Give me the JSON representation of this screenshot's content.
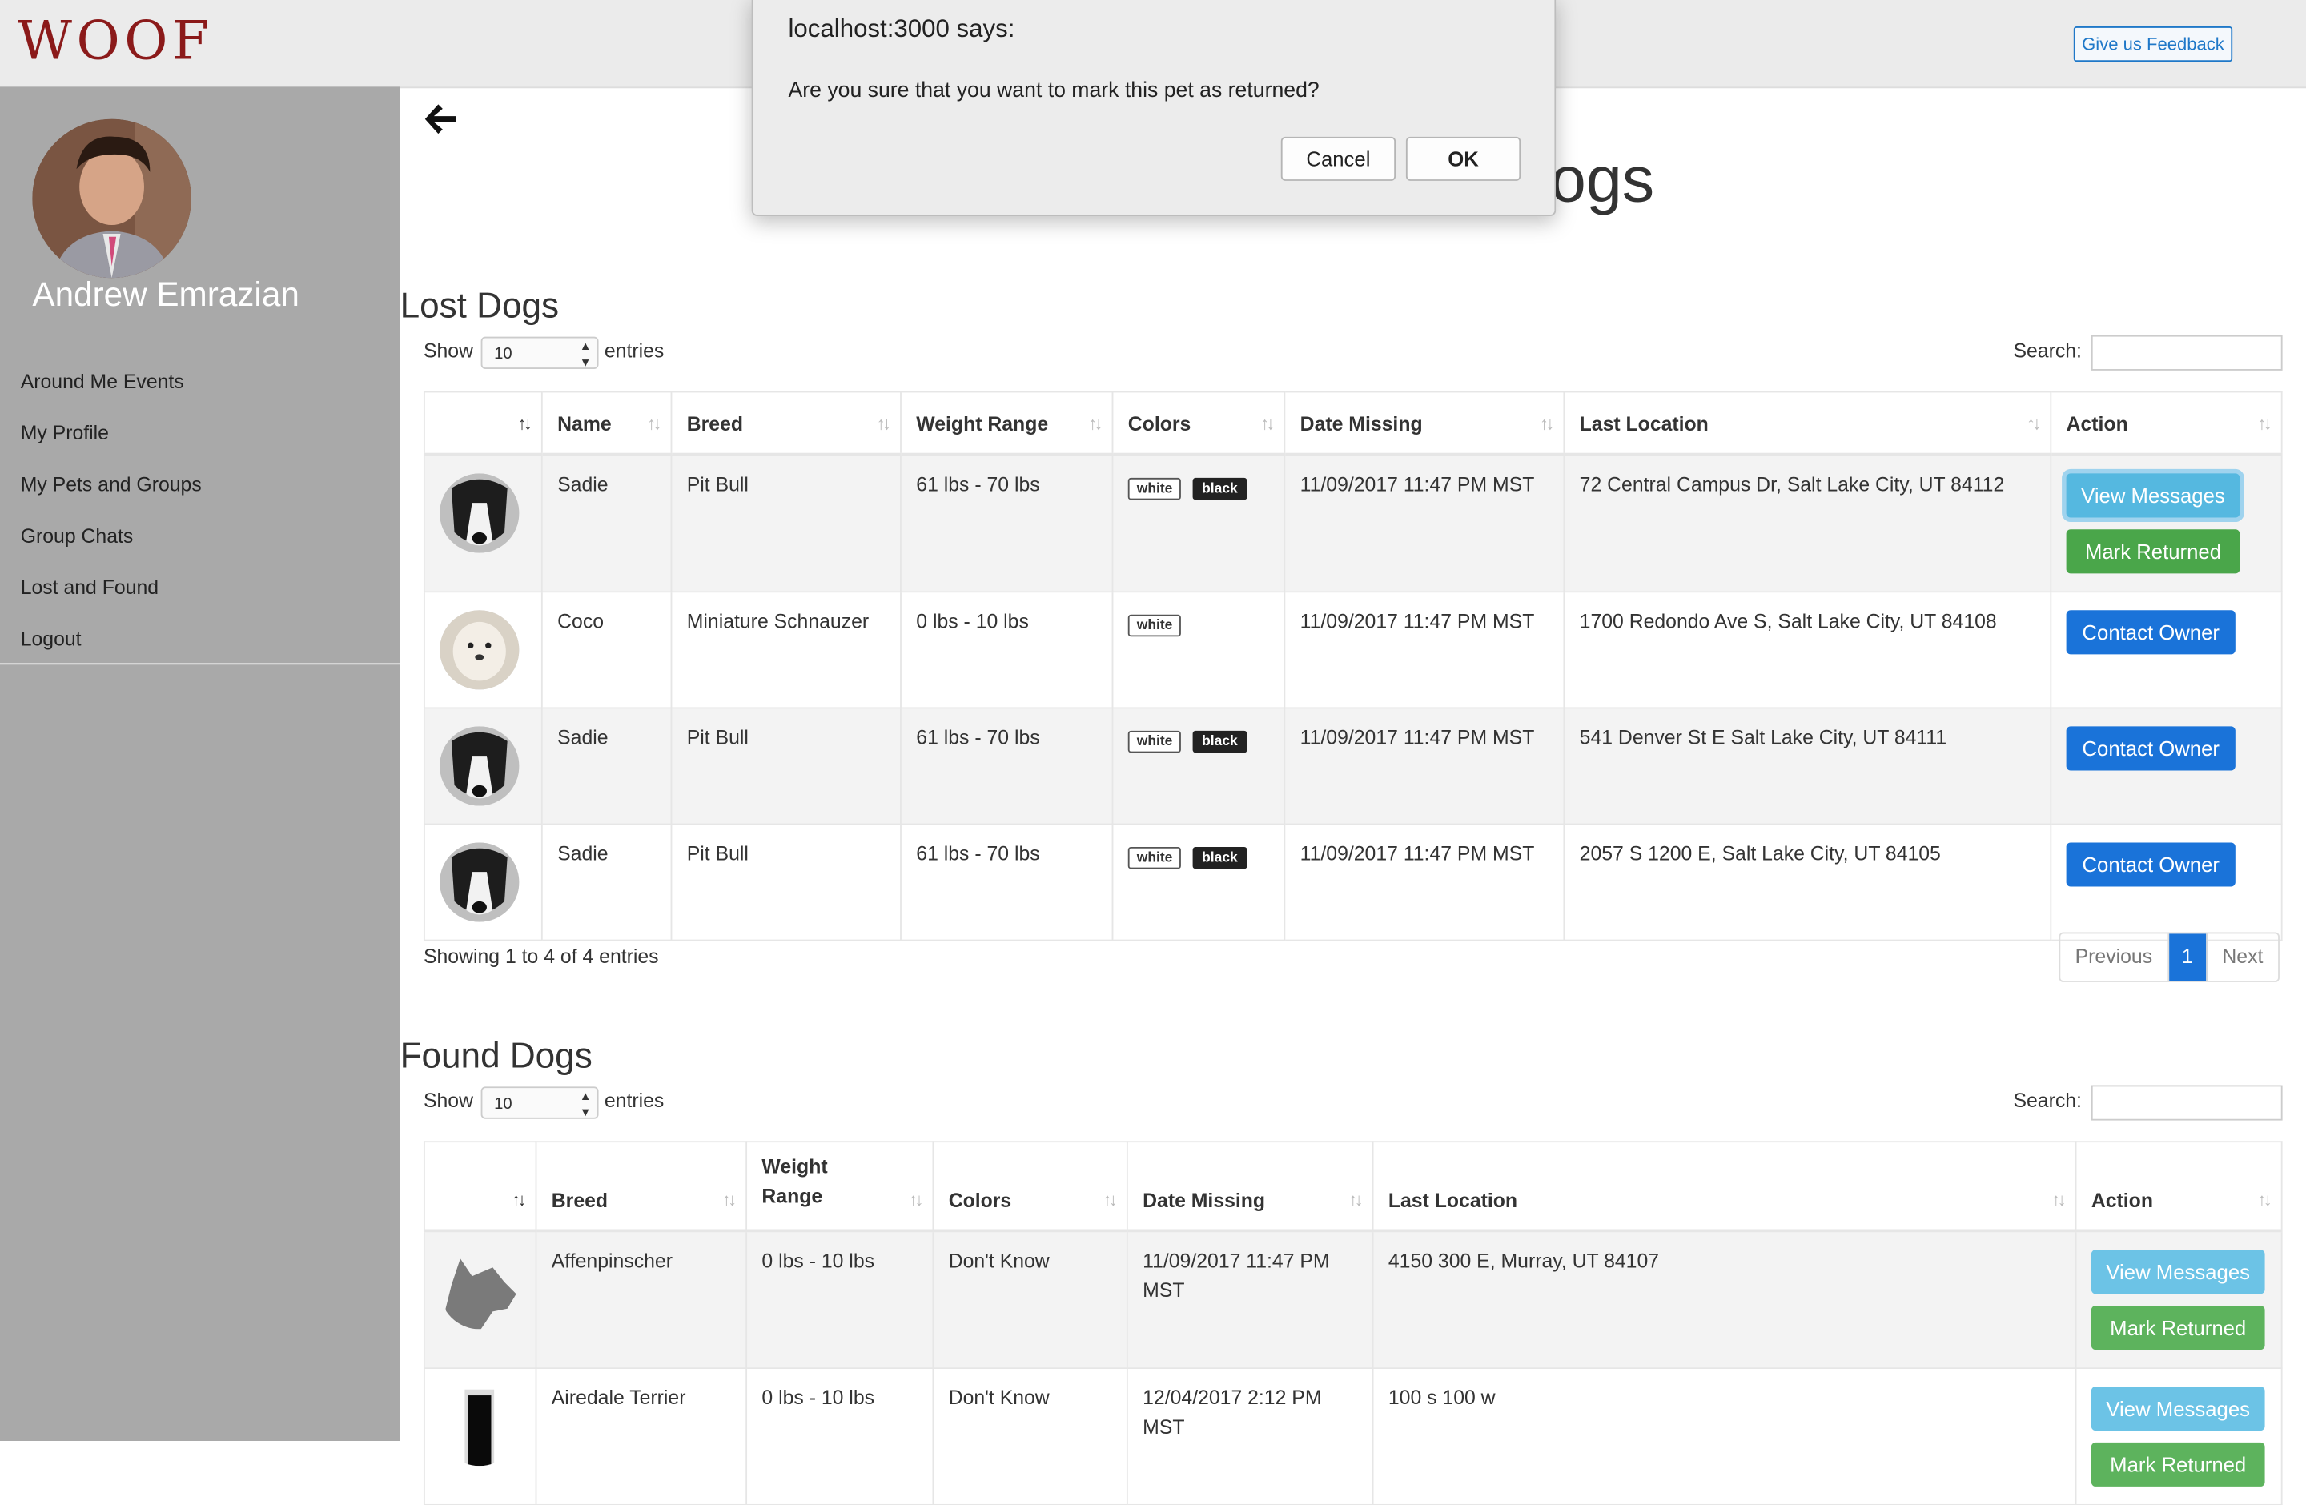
{
  "app": {
    "logo": "WOOF",
    "feedback_label": "Give us Feedback"
  },
  "user": {
    "name": "Andrew Emrazian"
  },
  "sidebar": {
    "items": [
      {
        "label": "Around Me Events"
      },
      {
        "label": "My Profile"
      },
      {
        "label": "My Pets and Groups"
      },
      {
        "label": "Group Chats"
      },
      {
        "label": "Lost and Found"
      },
      {
        "label": "Logout"
      }
    ]
  },
  "page": {
    "title_visible": "ogs"
  },
  "dialog": {
    "title": "localhost:3000 says:",
    "message": "Are you sure that you want to mark this pet as returned?",
    "cancel_label": "Cancel",
    "ok_label": "OK"
  },
  "lost": {
    "title": "Lost Dogs",
    "show_label": "Show",
    "entries_label": "entries",
    "length_value": "10",
    "search_label": "Search:",
    "columns": [
      "",
      "Name",
      "Breed",
      "Weight Range",
      "Colors",
      "Date Missing",
      "Last Location",
      "Action"
    ],
    "rows": [
      {
        "name": "Sadie",
        "breed": "Pit Bull",
        "weight": "61 lbs - 70 lbs",
        "colors": [
          "white",
          "black"
        ],
        "date": "11/09/2017 11:47 PM MST",
        "location": "72 Central Campus Dr, Salt Lake City, UT 84112",
        "actions": [
          "View Messages",
          "Mark Returned"
        ]
      },
      {
        "name": "Coco",
        "breed": "Miniature Schnauzer",
        "weight": "0 lbs - 10 lbs",
        "colors": [
          "white"
        ],
        "date": "11/09/2017 11:47 PM MST",
        "location": "1700 Redondo Ave S, Salt Lake City, UT 84108",
        "actions": [
          "Contact Owner"
        ]
      },
      {
        "name": "Sadie",
        "breed": "Pit Bull",
        "weight": "61 lbs - 70 lbs",
        "colors": [
          "white",
          "black"
        ],
        "date": "11/09/2017 11:47 PM MST",
        "location": "541 Denver St E Salt Lake City, UT 84111",
        "actions": [
          "Contact Owner"
        ]
      },
      {
        "name": "Sadie",
        "breed": "Pit Bull",
        "weight": "61 lbs - 70 lbs",
        "colors": [
          "white",
          "black"
        ],
        "date": "11/09/2017 11:47 PM MST",
        "location": "2057 S 1200 E, Salt Lake City, UT 84105",
        "actions": [
          "Contact Owner"
        ]
      }
    ],
    "info": "Showing 1 to 4 of 4 entries",
    "pager": {
      "previous": "Previous",
      "current": "1",
      "next": "Next"
    }
  },
  "found": {
    "title": "Found Dogs",
    "show_label": "Show",
    "entries_label": "entries",
    "length_value": "10",
    "search_label": "Search:",
    "columns": [
      "",
      "Breed",
      "Weight Range",
      "Colors",
      "Date Missing",
      "Last Location",
      "Action"
    ],
    "rows": [
      {
        "breed": "Affenpinscher",
        "weight": "0 lbs - 10 lbs",
        "colors": "Don't Know",
        "date": "11/09/2017 11:47 PM MST",
        "location": "4150 300 E, Murray, UT 84107",
        "actions": [
          "View Messages",
          "Mark Returned"
        ]
      },
      {
        "breed": "Airedale Terrier",
        "weight": "0 lbs - 10 lbs",
        "colors": "Don't Know",
        "date": "12/04/2017 2:12 PM MST",
        "location": "100 s 100 w",
        "actions": [
          "View Messages",
          "Mark Returned"
        ]
      }
    ]
  }
}
